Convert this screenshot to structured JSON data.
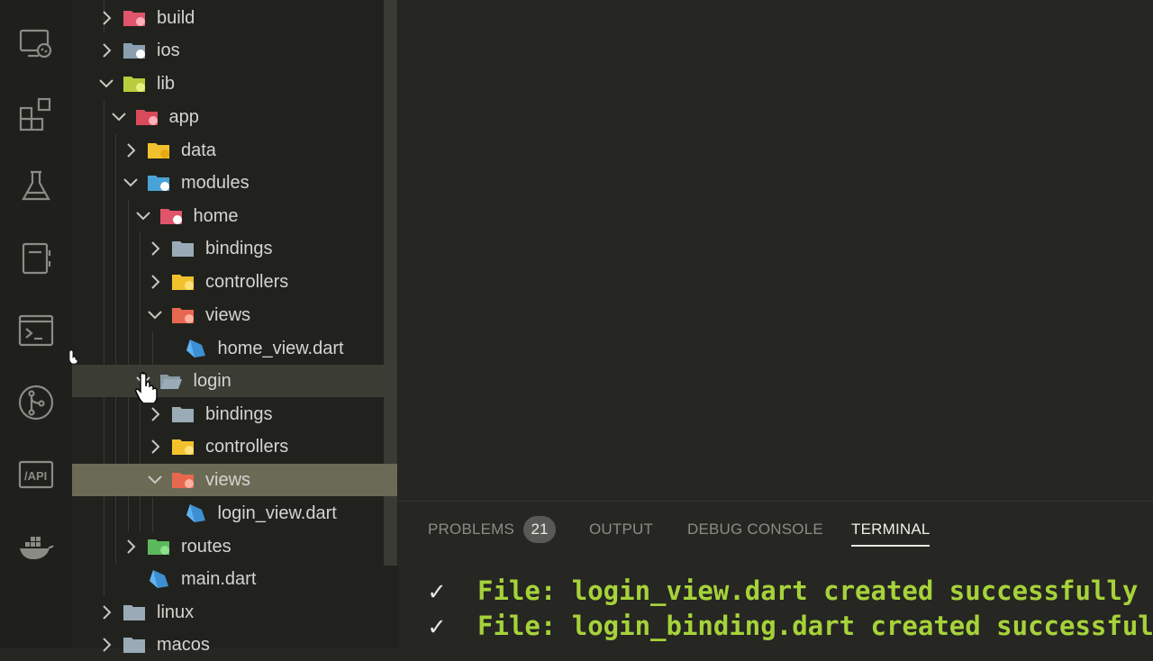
{
  "activity_bar": {
    "icons": [
      "remote-explorer-icon",
      "extensions-icon",
      "testing-icon",
      "notebook-icon",
      "terminal-icon",
      "source-control-icon",
      "api-icon",
      "docker-icon"
    ]
  },
  "explorer": {
    "items": [
      {
        "label": "build",
        "expanded": false,
        "icon": "folder-build-icon",
        "color": "#e0556b"
      },
      {
        "label": "ios",
        "expanded": false,
        "icon": "folder-ios-icon",
        "color": "#8aa0b0"
      },
      {
        "label": "lib",
        "expanded": true,
        "icon": "folder-lib-icon",
        "color": "#b8cc3c"
      },
      {
        "label": "app",
        "expanded": true,
        "icon": "folder-app-icon",
        "color": "#d94a5a"
      },
      {
        "label": "data",
        "expanded": false,
        "icon": "folder-data-icon",
        "color": "#f2c12e"
      },
      {
        "label": "modules",
        "expanded": true,
        "icon": "folder-modules-icon",
        "color": "#4aa3d8"
      },
      {
        "label": "home",
        "expanded": true,
        "icon": "folder-home-icon",
        "color": "#e0556b"
      },
      {
        "label": "bindings",
        "expanded": false,
        "icon": "folder-icon",
        "color": "#9aaab6"
      },
      {
        "label": "controllers",
        "expanded": false,
        "icon": "folder-controllers-icon",
        "color": "#f2c12e"
      },
      {
        "label": "views",
        "expanded": true,
        "icon": "folder-views-icon",
        "color": "#e8674f"
      },
      {
        "label": "home_view.dart",
        "icon": "dart-file-icon",
        "color": "#3d8fd4"
      },
      {
        "label": "login",
        "expanded": true,
        "icon": "folder-open-icon",
        "color": "#9aaab6"
      },
      {
        "label": "bindings",
        "expanded": false,
        "icon": "folder-icon",
        "color": "#9aaab6"
      },
      {
        "label": "controllers",
        "expanded": false,
        "icon": "folder-controllers-icon",
        "color": "#f2c12e"
      },
      {
        "label": "views",
        "expanded": true,
        "icon": "folder-views-icon",
        "color": "#e8674f"
      },
      {
        "label": "login_view.dart",
        "icon": "dart-file-icon",
        "color": "#3d8fd4"
      },
      {
        "label": "routes",
        "expanded": false,
        "icon": "folder-routes-icon",
        "color": "#5cb85c"
      },
      {
        "label": "main.dart",
        "icon": "dart-file-icon",
        "color": "#3d8fd4"
      },
      {
        "label": "linux",
        "expanded": false,
        "icon": "folder-icon",
        "color": "#9aaab6"
      },
      {
        "label": "macos",
        "expanded": false,
        "icon": "folder-icon",
        "color": "#9aaab6"
      }
    ]
  },
  "panel": {
    "tabs": {
      "problems": "PROBLEMS",
      "output": "OUTPUT",
      "debug_console": "DEBUG CONSOLE",
      "terminal": "TERMINAL"
    },
    "problems_count": "21",
    "active_tab": "TERMINAL"
  },
  "terminal": {
    "lines": [
      {
        "check": "✓",
        "text": "File: login_view.dart created successfully"
      },
      {
        "check": "✓",
        "text": "File: login_binding.dart created successfully"
      }
    ]
  }
}
